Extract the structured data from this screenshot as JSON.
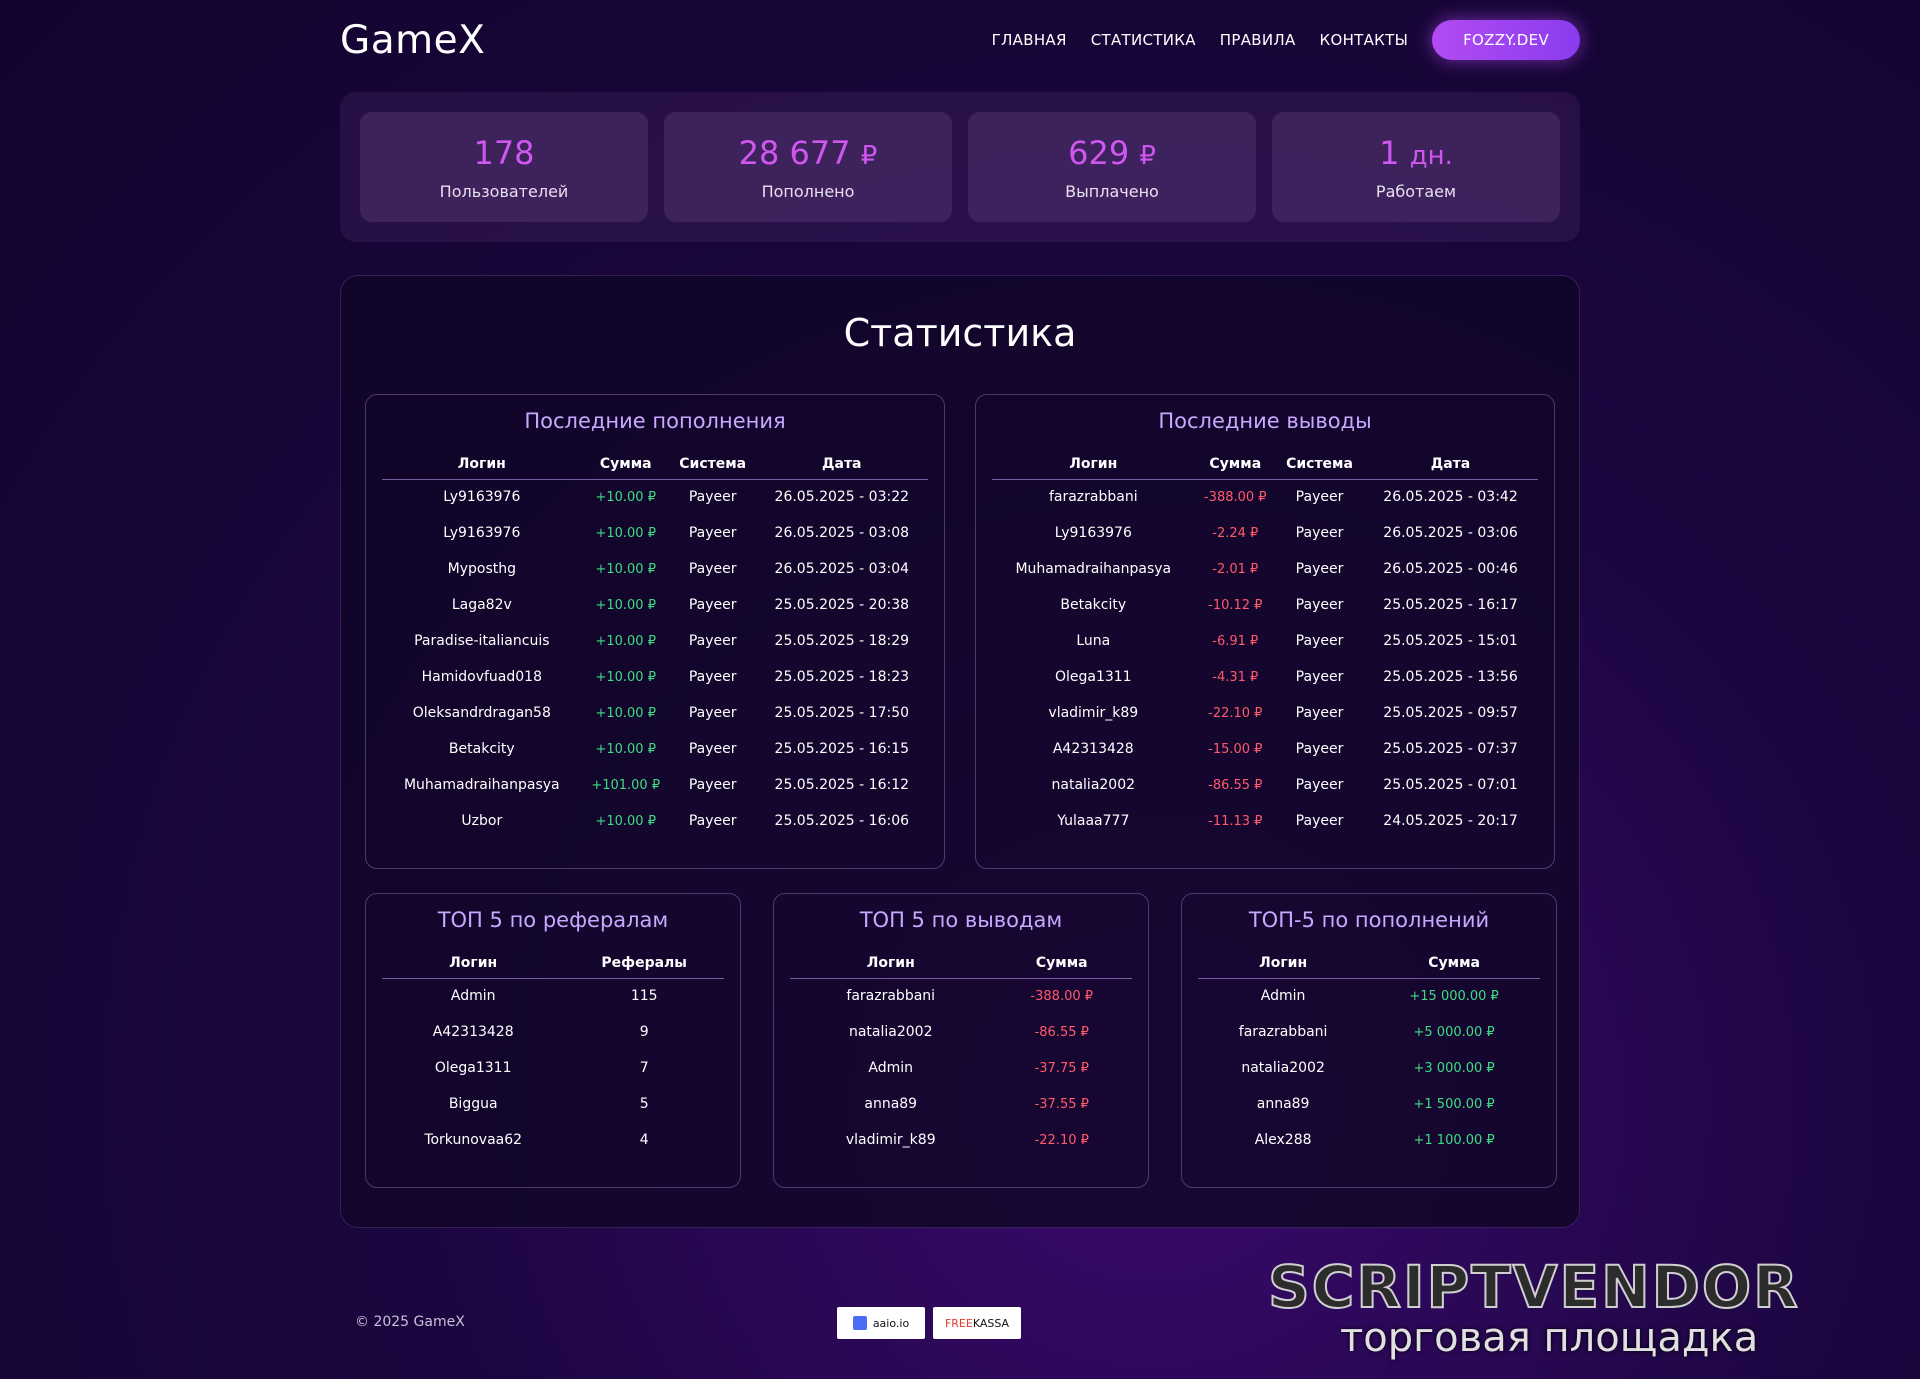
{
  "header": {
    "logo": "GameX",
    "nav": [
      "ГЛАВНАЯ",
      "СТАТИСТИКА",
      "ПРАВИЛА",
      "КОНТАКТЫ"
    ],
    "user_button": "FOZZY.DEV"
  },
  "stats": [
    {
      "value": "178",
      "unit": "",
      "label": "Пользователей"
    },
    {
      "value": "28 677",
      "unit": "₽",
      "label": "Пополнено"
    },
    {
      "value": "629",
      "unit": "₽",
      "label": "Выплачено"
    },
    {
      "value": "1",
      "unit": "дн.",
      "label": "Работаем"
    }
  ],
  "page_title": "Статистика",
  "deposits": {
    "title": "Последние пополнения",
    "columns": [
      "Логин",
      "Сумма",
      "Система",
      "Дата"
    ],
    "rows": [
      [
        "Ly9163976",
        "+10.00 ₽",
        "Payeer",
        "26.05.2025 - 03:22"
      ],
      [
        "Ly9163976",
        "+10.00 ₽",
        "Payeer",
        "26.05.2025 - 03:08"
      ],
      [
        "Myposthg",
        "+10.00 ₽",
        "Payeer",
        "26.05.2025 - 03:04"
      ],
      [
        "Laga82v",
        "+10.00 ₽",
        "Payeer",
        "25.05.2025 - 20:38"
      ],
      [
        "Paradise-italiancuis",
        "+10.00 ₽",
        "Payeer",
        "25.05.2025 - 18:29"
      ],
      [
        "Hamidovfuad018",
        "+10.00 ₽",
        "Payeer",
        "25.05.2025 - 18:23"
      ],
      [
        "Oleksandrdragan58",
        "+10.00 ₽",
        "Payeer",
        "25.05.2025 - 17:50"
      ],
      [
        "Betakcity",
        "+10.00 ₽",
        "Payeer",
        "25.05.2025 - 16:15"
      ],
      [
        "Muhamadraihanpasya",
        "+101.00 ₽",
        "Payeer",
        "25.05.2025 - 16:12"
      ],
      [
        "Uzbor",
        "+10.00 ₽",
        "Payeer",
        "25.05.2025 - 16:06"
      ]
    ]
  },
  "withdrawals": {
    "title": "Последние выводы",
    "columns": [
      "Логин",
      "Сумма",
      "Система",
      "Дата"
    ],
    "rows": [
      [
        "farazrabbani",
        "-388.00 ₽",
        "Payeer",
        "26.05.2025 - 03:42"
      ],
      [
        "Ly9163976",
        "-2.24 ₽",
        "Payeer",
        "26.05.2025 - 03:06"
      ],
      [
        "Muhamadraihanpasya",
        "-2.01 ₽",
        "Payeer",
        "26.05.2025 - 00:46"
      ],
      [
        "Betakcity",
        "-10.12 ₽",
        "Payeer",
        "25.05.2025 - 16:17"
      ],
      [
        "Luna",
        "-6.91 ₽",
        "Payeer",
        "25.05.2025 - 15:01"
      ],
      [
        "Olega1311",
        "-4.31 ₽",
        "Payeer",
        "25.05.2025 - 13:56"
      ],
      [
        "vladimir_k89",
        "-22.10 ₽",
        "Payeer",
        "25.05.2025 - 09:57"
      ],
      [
        "A42313428",
        "-15.00 ₽",
        "Payeer",
        "25.05.2025 - 07:37"
      ],
      [
        "natalia2002",
        "-86.55 ₽",
        "Payeer",
        "25.05.2025 - 07:01"
      ],
      [
        "Yulaaa777",
        "-11.13 ₽",
        "Payeer",
        "24.05.2025 - 20:17"
      ]
    ]
  },
  "top_referrals": {
    "title": "ТОП 5 по рефералам",
    "columns": [
      "Логин",
      "Рефералы"
    ],
    "rows": [
      [
        "Admin",
        "115"
      ],
      [
        "A42313428",
        "9"
      ],
      [
        "Olega1311",
        "7"
      ],
      [
        "Biggua",
        "5"
      ],
      [
        "Torkunovaa62",
        "4"
      ]
    ]
  },
  "top_withdrawals": {
    "title": "ТОП 5 по выводам",
    "columns": [
      "Логин",
      "Сумма"
    ],
    "rows": [
      [
        "farazrabbani",
        "-388.00 ₽"
      ],
      [
        "natalia2002",
        "-86.55 ₽"
      ],
      [
        "Admin",
        "-37.75 ₽"
      ],
      [
        "anna89",
        "-37.55 ₽"
      ],
      [
        "vladimir_k89",
        "-22.10 ₽"
      ]
    ]
  },
  "top_deposits": {
    "title": "ТОП-5 по пополнений",
    "columns": [
      "Логин",
      "Сумма"
    ],
    "rows": [
      [
        "Admin",
        "+15 000.00 ₽"
      ],
      [
        "farazrabbani",
        "+5 000.00 ₽"
      ],
      [
        "natalia2002",
        "+3 000.00 ₽"
      ],
      [
        "anna89",
        "+1 500.00 ₽"
      ],
      [
        "Alex288",
        "+1 100.00 ₽"
      ]
    ]
  },
  "footer": {
    "copyright": "© 2025 GameX",
    "badge_aaio": "aaio.io",
    "badge_free_prefix": "FREE",
    "badge_free_suffix": "KASSA"
  },
  "watermark": {
    "main": "SCRIPTVENDOR",
    "sub": "торговая площадка"
  }
}
